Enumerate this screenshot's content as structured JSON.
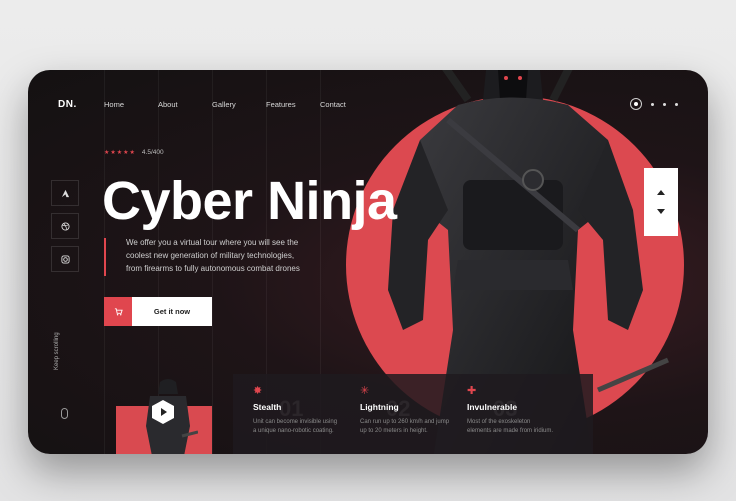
{
  "brand": {
    "logo": "DN."
  },
  "nav": {
    "items": [
      "Home",
      "About",
      "Gallery",
      "Features",
      "Contact"
    ]
  },
  "rating": {
    "value": "4.5/400"
  },
  "hero": {
    "title": "Cyber Ninja",
    "description_lines": [
      "We offer you a virtual tour where you will see the",
      "coolest new generation of military technologies,",
      "from firearms to fully autonomous combat drones"
    ],
    "cta_label": "Get it now"
  },
  "scroll_hint": "Keep scrolling",
  "features": [
    {
      "num": "01",
      "title": "Stealth",
      "desc_lines": [
        "Unit can become invisible using",
        "a unique nano-robotic coating."
      ]
    },
    {
      "num": "02",
      "title": "Lightning",
      "desc_lines": [
        "Can run up to 260 km/h and jump",
        "up to 20 meters in height."
      ]
    },
    {
      "num": "03",
      "title": "Invulnerable",
      "desc_lines": [
        "Most of the exoskeleton",
        "elements are made from iridium."
      ]
    }
  ],
  "colors": {
    "accent": "#e0464e",
    "background": "#1a1315",
    "page": "#e9e9ea"
  },
  "icons": {
    "social": [
      "adobe-icon",
      "dribbble-icon",
      "instagram-icon"
    ],
    "cta": "cart-icon",
    "video": "play-icon"
  }
}
